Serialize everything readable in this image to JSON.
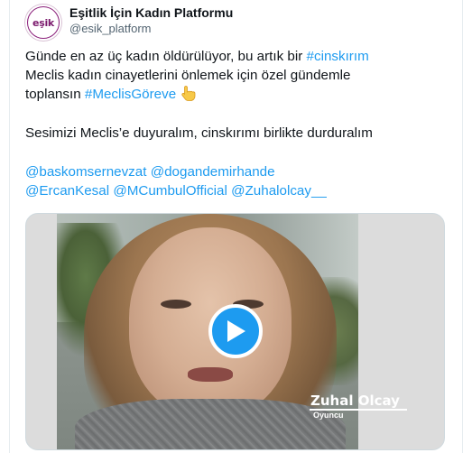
{
  "author": {
    "name": "Eşitlik İçin Kadın Platformu",
    "handle": "@esik_platform",
    "avatar_text": "eşik"
  },
  "tweet": {
    "line1_text": "Günde en az üç kadın öldürülüyor, bu artık bir ",
    "line1_hashtag": "#cinskırım",
    "line2_text": "Meclis kadın cinayetlerini önlemek için özel gündemle",
    "line3_text": "toplansın ",
    "line3_hashtag": "#MeclisGöreve",
    "line3_emoji": "pointing-up-hand-emoji",
    "line4_text": "Sesimizi Meclis’e duyuralım, cinskırımı birlikte durduralım",
    "mention1": "@baskomsernevzat",
    "mention2": "@dogandemirhande",
    "mention3": "@ErcanKesal",
    "mention4": "@MCumbulOfficial",
    "mention5": "@Zuhalolcay__"
  },
  "media": {
    "type": "video",
    "caption_name": "Zuhal Olcay",
    "caption_role": "Oyuncu",
    "play_icon": "play-icon"
  },
  "colors": {
    "link": "#1d9bf0",
    "play_button": "#1d9bf0",
    "avatar_brand": "#8a1f7a"
  }
}
